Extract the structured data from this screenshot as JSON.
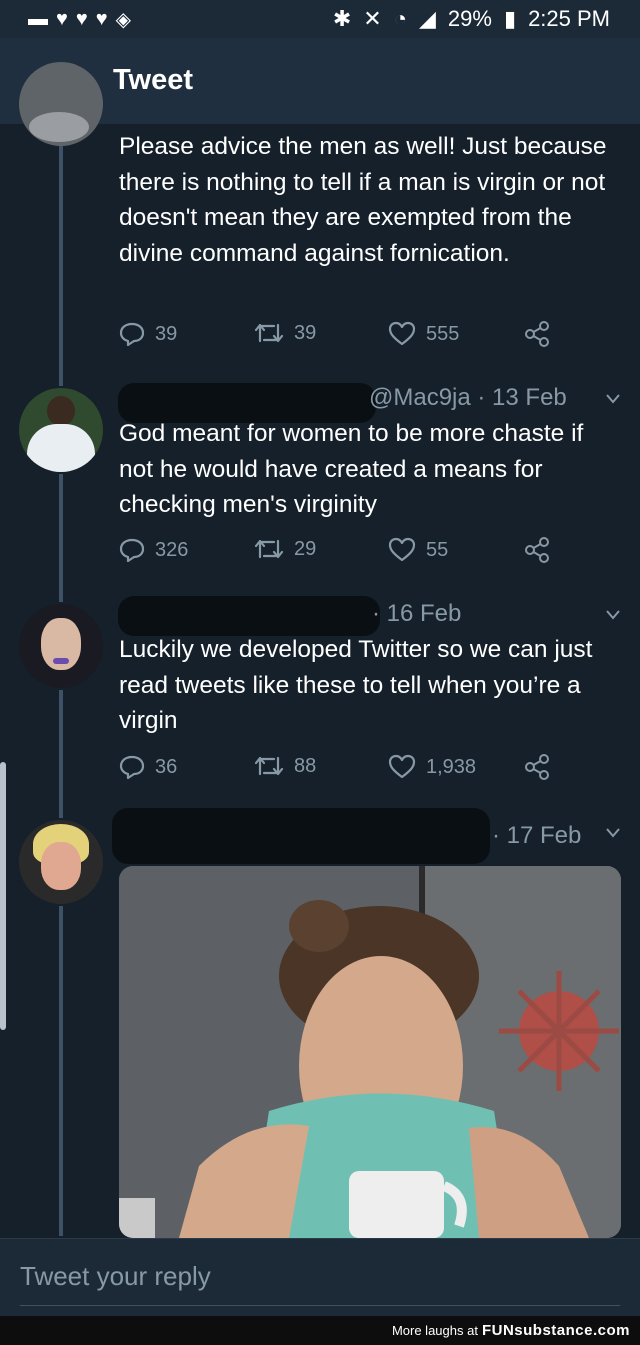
{
  "status_bar": {
    "battery": "29%",
    "time": "2:25 PM"
  },
  "app_bar": {
    "title": "Tweet"
  },
  "tweets": [
    {
      "text": "Please advice the men as well! Just because there is nothing to tell if a man is virgin or not doesn't mean they are exempted from the divine command against fornication.",
      "replies": "39",
      "retweets": "39",
      "likes": "555"
    },
    {
      "handle_date": "@Mac9ja · 13 Feb",
      "text": "God meant for women to be more chaste if not he would have created a means for checking men's virginity",
      "replies": "326",
      "retweets": "29",
      "likes": "55"
    },
    {
      "handle_date": "· 16 Feb",
      "text": "Luckily we developed Twitter so we can just read tweets like these to tell when you’re a virgin",
      "replies": "36",
      "retweets": "88",
      "likes": "1,938"
    },
    {
      "handle_date": "· 17 Feb"
    }
  ],
  "reply": {
    "placeholder": "Tweet your reply"
  },
  "footer": {
    "prefix": "More laughs at",
    "brand": "FUNsubstance.com"
  },
  "colors": {
    "background": "#15202b",
    "muted": "#8899a6",
    "accent": "#1da1f2"
  }
}
